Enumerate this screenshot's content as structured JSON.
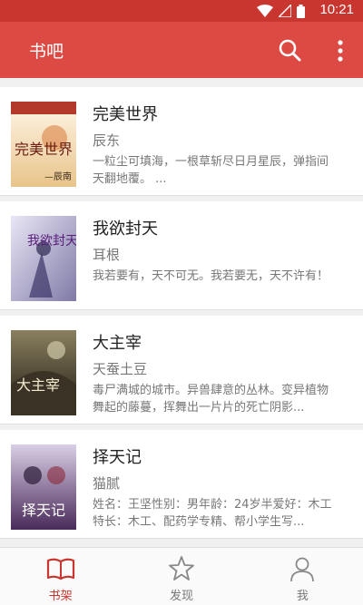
{
  "status": {
    "time": "10:21"
  },
  "header": {
    "title": "书吧"
  },
  "books": [
    {
      "title": "完美世界",
      "author": "辰东",
      "description": "一粒尘可填海，一根草斩尽日月星辰，弹指间天翻地覆。 ...",
      "cover_text": "完美世界",
      "cover_sub": "—辰南"
    },
    {
      "title": "我欲封天",
      "author": "耳根",
      "description": "我若要有，天不可无。我若要无，天不许有！",
      "cover_text": "我欲封天",
      "cover_sub": ""
    },
    {
      "title": "大主宰",
      "author": "天蚕土豆",
      "description": "毒尸满城的城市。异兽肆意的丛林。变异植物舞起的藤蔓，挥舞出一片片的死亡阴影...",
      "cover_text": "大主宰",
      "cover_sub": ""
    },
    {
      "title": "择天记",
      "author": "猫腻",
      "description": "姓名：王坚性别：男年龄：24岁半爱好：木工特长：木工、配药学专精、帮小学生写...",
      "cover_text": "择天记",
      "cover_sub": ""
    }
  ],
  "tabs": [
    {
      "label": "书架",
      "icon": "open-book-icon"
    },
    {
      "label": "发现",
      "icon": "star-icon"
    },
    {
      "label": "我",
      "icon": "person-icon"
    }
  ],
  "colors": {
    "statusbar": "#c9362f",
    "appbar": "#dd4a43",
    "accent": "#c9362f"
  }
}
